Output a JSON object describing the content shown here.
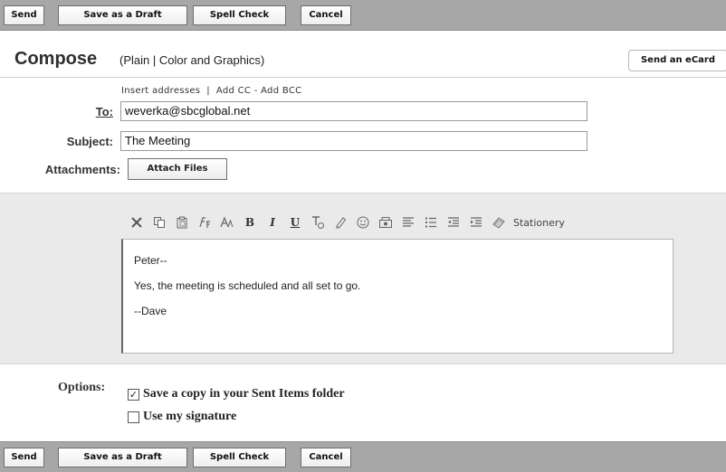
{
  "toolbar": {
    "send": "Send",
    "draft": "Save as a Draft",
    "spell": "Spell Check",
    "cancel": "Cancel"
  },
  "header": {
    "title": "Compose",
    "mode_open": "(",
    "mode_plain": "Plain",
    "mode_sep": " | ",
    "mode_color": "Color and Graphics",
    "mode_close": ")",
    "ecard": "Send an eCard"
  },
  "address_links": {
    "insert": "Insert addresses",
    "sep1": "  |  ",
    "add_cc": "Add CC",
    "sep2": " - ",
    "add_bcc": "Add BCC"
  },
  "fields": {
    "to_label": "To:",
    "to_value": "weverka@sbcglobal.net",
    "subject_label": "Subject:",
    "subject_value": "The Meeting",
    "attachments_label": "Attachments:",
    "attach_button": "Attach Files"
  },
  "formatting": {
    "stationery": "Stationery",
    "bold": "B",
    "italic": "I",
    "underline": "U"
  },
  "message": {
    "line1": "Peter--",
    "line2": "Yes, the meeting is scheduled and all set to go.",
    "line3": "--Dave"
  },
  "options": {
    "label": "Options:",
    "save_copy": "Save a copy in your Sent Items folder",
    "save_copy_checked": true,
    "signature": "Use my signature",
    "signature_checked": false,
    "check_mark": "✓"
  }
}
